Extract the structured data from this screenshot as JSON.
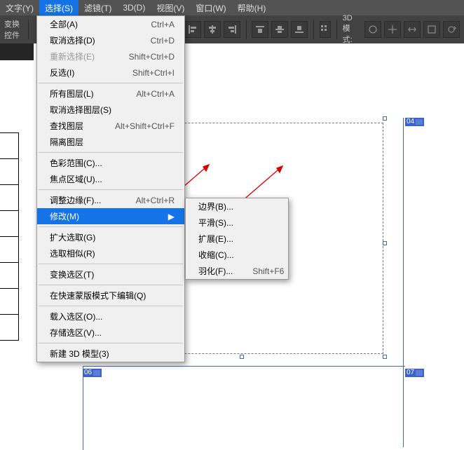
{
  "menubar": {
    "items": [
      {
        "label": "文字(Y)"
      },
      {
        "label": "选择(S)"
      },
      {
        "label": "滤镜(T)"
      },
      {
        "label": "3D(D)"
      },
      {
        "label": "视图(V)"
      },
      {
        "label": "窗口(W)"
      },
      {
        "label": "帮助(H)"
      }
    ]
  },
  "toolbar": {
    "transform_label": "变换控件",
    "three_d_label": "3D 模式:"
  },
  "tab": {
    "label": "×"
  },
  "dropdown_main": [
    {
      "label": "全部(A)",
      "shortcut": "Ctrl+A"
    },
    {
      "label": "取消选择(D)",
      "shortcut": "Ctrl+D"
    },
    {
      "label": "重新选择(E)",
      "shortcut": "Shift+Ctrl+D",
      "disabled": true
    },
    {
      "label": "反选(I)",
      "shortcut": "Shift+Ctrl+I"
    },
    {
      "sep": true
    },
    {
      "label": "所有图层(L)",
      "shortcut": "Alt+Ctrl+A"
    },
    {
      "label": "取消选择图层(S)"
    },
    {
      "label": "查找图层",
      "shortcut": "Alt+Shift+Ctrl+F"
    },
    {
      "label": "隔离图层"
    },
    {
      "sep": true
    },
    {
      "label": "色彩范围(C)..."
    },
    {
      "label": "焦点区域(U)..."
    },
    {
      "sep": true
    },
    {
      "label": "调整边缘(F)...",
      "shortcut": "Alt+Ctrl+R"
    },
    {
      "label": "修改(M)",
      "highlighted": true,
      "submenu": true
    },
    {
      "sep": true
    },
    {
      "label": "扩大选取(G)"
    },
    {
      "label": "选取相似(R)"
    },
    {
      "sep": true
    },
    {
      "label": "变换选区(T)"
    },
    {
      "sep": true
    },
    {
      "label": "在快速蒙版模式下编辑(Q)"
    },
    {
      "sep": true
    },
    {
      "label": "载入选区(O)..."
    },
    {
      "label": "存储选区(V)..."
    },
    {
      "sep": true
    },
    {
      "label": "新建 3D 模型(3)"
    }
  ],
  "dropdown_sub": [
    {
      "label": "边界(B)..."
    },
    {
      "label": "平滑(S)..."
    },
    {
      "label": "扩展(E)..."
    },
    {
      "label": "收缩(C)..."
    },
    {
      "label": "羽化(F)...",
      "shortcut": "Shift+F6"
    }
  ],
  "slice_labels": {
    "s04": "04",
    "s06": "06",
    "s07": "07"
  }
}
